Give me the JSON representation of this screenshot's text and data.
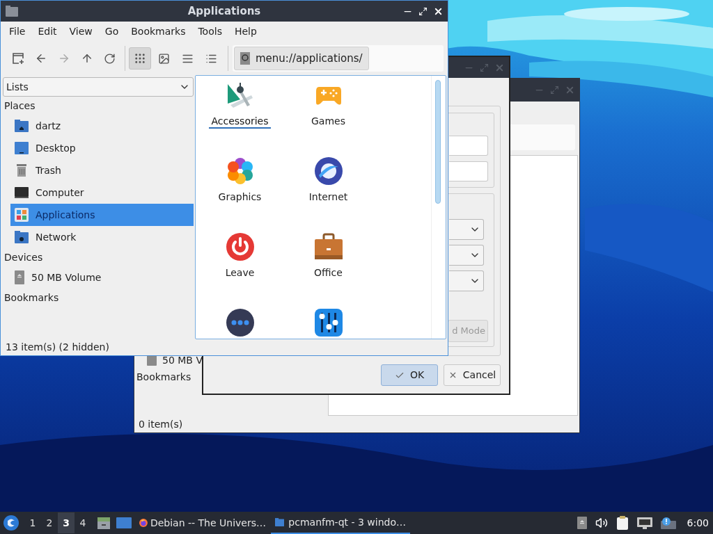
{
  "back_window": {
    "device_item": "50 MB V",
    "section_heading": "Bookmarks",
    "status_bar": "0 item(s)"
  },
  "dialog": {
    "mode_button": "d Mode",
    "buttons": [
      {
        "label": "OK",
        "default": true
      },
      {
        "label": "Cancel",
        "default": false
      }
    ]
  },
  "main_window": {
    "title": "Applications",
    "menu": [
      "File",
      "Edit",
      "View",
      "Go",
      "Bookmarks",
      "Tools",
      "Help"
    ],
    "nav_buttons": [
      {
        "disabled": false
      },
      {
        "disabled": false
      },
      {
        "disabled": true
      },
      {
        "disabled": false
      },
      {
        "disabled": false
      }
    ],
    "view_buttons": [
      {
        "selected": true
      },
      {
        "selected": false
      },
      {
        "selected": false
      },
      {
        "selected": false
      }
    ],
    "path": "menu://applications/",
    "side_pane": {
      "selector": "Lists",
      "sections": [
        {
          "heading": "Places",
          "items": [
            {
              "label": "dartz",
              "selected": false
            },
            {
              "label": "Desktop",
              "selected": false
            },
            {
              "label": "Trash",
              "selected": false
            },
            {
              "label": "Computer",
              "selected": false
            },
            {
              "label": "Applications",
              "selected": true
            },
            {
              "label": "Network",
              "selected": false
            }
          ]
        },
        {
          "heading": "Devices",
          "items": [
            {
              "label": "50 MB Volume",
              "selected": false
            }
          ]
        },
        {
          "heading": "Bookmarks"
        }
      ]
    },
    "icons": [
      {
        "label": "Accessories",
        "selected": true
      },
      {
        "label": "Games",
        "selected": false
      },
      {
        "label": "Graphics",
        "selected": false
      },
      {
        "label": "Internet",
        "selected": false
      },
      {
        "label": "Leave",
        "selected": false
      },
      {
        "label": "Office",
        "selected": false
      },
      {
        "selected": false
      },
      {
        "selected": false
      }
    ],
    "status_bar": "13 item(s) (2 hidden)"
  },
  "taskbar": {
    "workspaces": [
      {
        "label": "1",
        "selected": false
      },
      {
        "label": "2",
        "selected": false
      },
      {
        "label": "3",
        "selected": true
      },
      {
        "label": "4",
        "selected": false
      }
    ],
    "tasks": [
      {
        "label": "Debian -- The Univers…",
        "selected": false
      },
      {
        "label": "pcmanfm-qt - 3 windo…",
        "selected": true
      }
    ],
    "clock": "6:00"
  }
}
